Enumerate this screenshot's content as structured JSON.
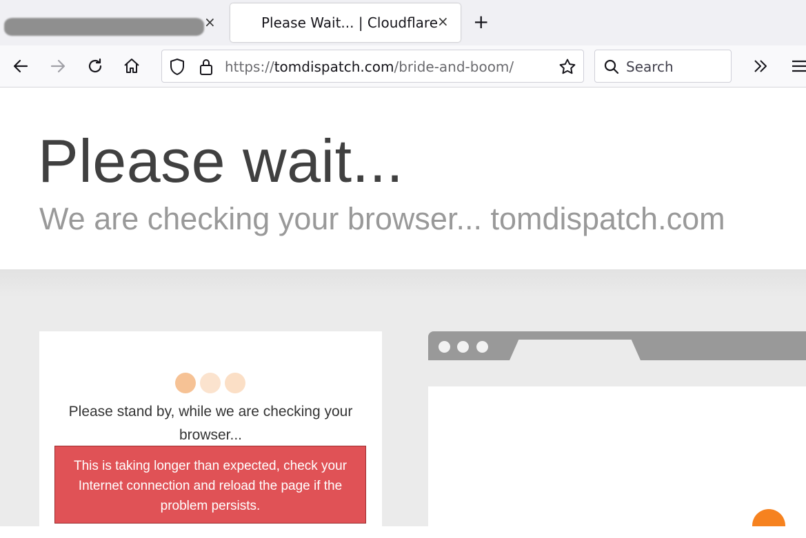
{
  "browser": {
    "tabs": [
      {
        "title": "",
        "redacted": true,
        "active": false
      },
      {
        "title": "Please Wait... | Cloudflare",
        "active": true
      }
    ],
    "close_glyph": "×",
    "new_tab_glyph": "+",
    "url": {
      "scheme": "https://",
      "host": "tomdispatch.com",
      "path": "/bride-and-boom/"
    },
    "search_placeholder": "Search",
    "icons": [
      "back-icon",
      "forward-icon",
      "reload-icon",
      "home-icon",
      "shield-icon",
      "lock-icon",
      "star-icon",
      "search-icon",
      "overflow-icon",
      "menu-icon"
    ]
  },
  "page": {
    "heading": "Please wait...",
    "subheading": "We are checking your browser... tomdispatch.com",
    "standby_text": "Please stand by, while we are checking your browser...",
    "alert_text": "This is taking longer than expected, check your Internet connection and reload the page if the problem persists."
  },
  "colors": {
    "alert_bg": "#e05256",
    "loader_dot_1": "#f6c295",
    "loader_dot_2": "#fbe3ce",
    "loader_dot_3": "#fbdfc6",
    "cloudflare_orange": "#f6821f"
  }
}
